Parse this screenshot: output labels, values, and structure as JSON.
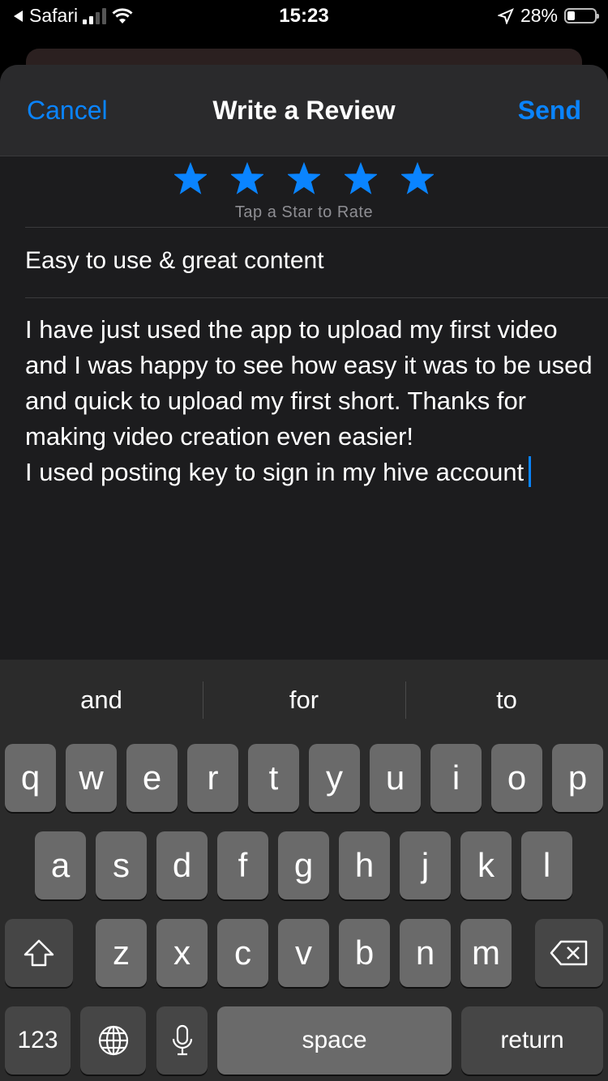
{
  "status_bar": {
    "back_app": "Safari",
    "time": "15:23",
    "battery_percent": "28%",
    "battery_level": 0.28
  },
  "sheet": {
    "cancel_label": "Cancel",
    "title": "Write a Review",
    "send_label": "Send",
    "rating": {
      "stars_filled": 5,
      "stars_total": 5,
      "hint": "Tap a Star to Rate"
    },
    "review_title": "Easy to use & great content",
    "review_body": "I have just used the app to upload my first video and I was happy to see how easy it was to be used and quick to upload my first short. Thanks for making video creation even easier!\nI used posting key to sign in my hive account"
  },
  "keyboard": {
    "suggestions": [
      "and",
      "for",
      "to"
    ],
    "row1": [
      "q",
      "w",
      "e",
      "r",
      "t",
      "y",
      "u",
      "i",
      "o",
      "p"
    ],
    "row2": [
      "a",
      "s",
      "d",
      "f",
      "g",
      "h",
      "j",
      "k",
      "l"
    ],
    "row3": [
      "z",
      "x",
      "c",
      "v",
      "b",
      "n",
      "m"
    ],
    "numbers_label": "123",
    "space_label": "space",
    "return_label": "return"
  },
  "colors": {
    "accent": "#0a84ff",
    "sheet_bg": "#1c1c1e",
    "key_bg": "#6a6a6a"
  },
  "icons": [
    "back-arrow-icon",
    "signal-icon",
    "wifi-icon",
    "location-icon",
    "battery-icon",
    "star-icon",
    "shift-icon",
    "backspace-icon",
    "globe-icon",
    "microphone-icon"
  ]
}
